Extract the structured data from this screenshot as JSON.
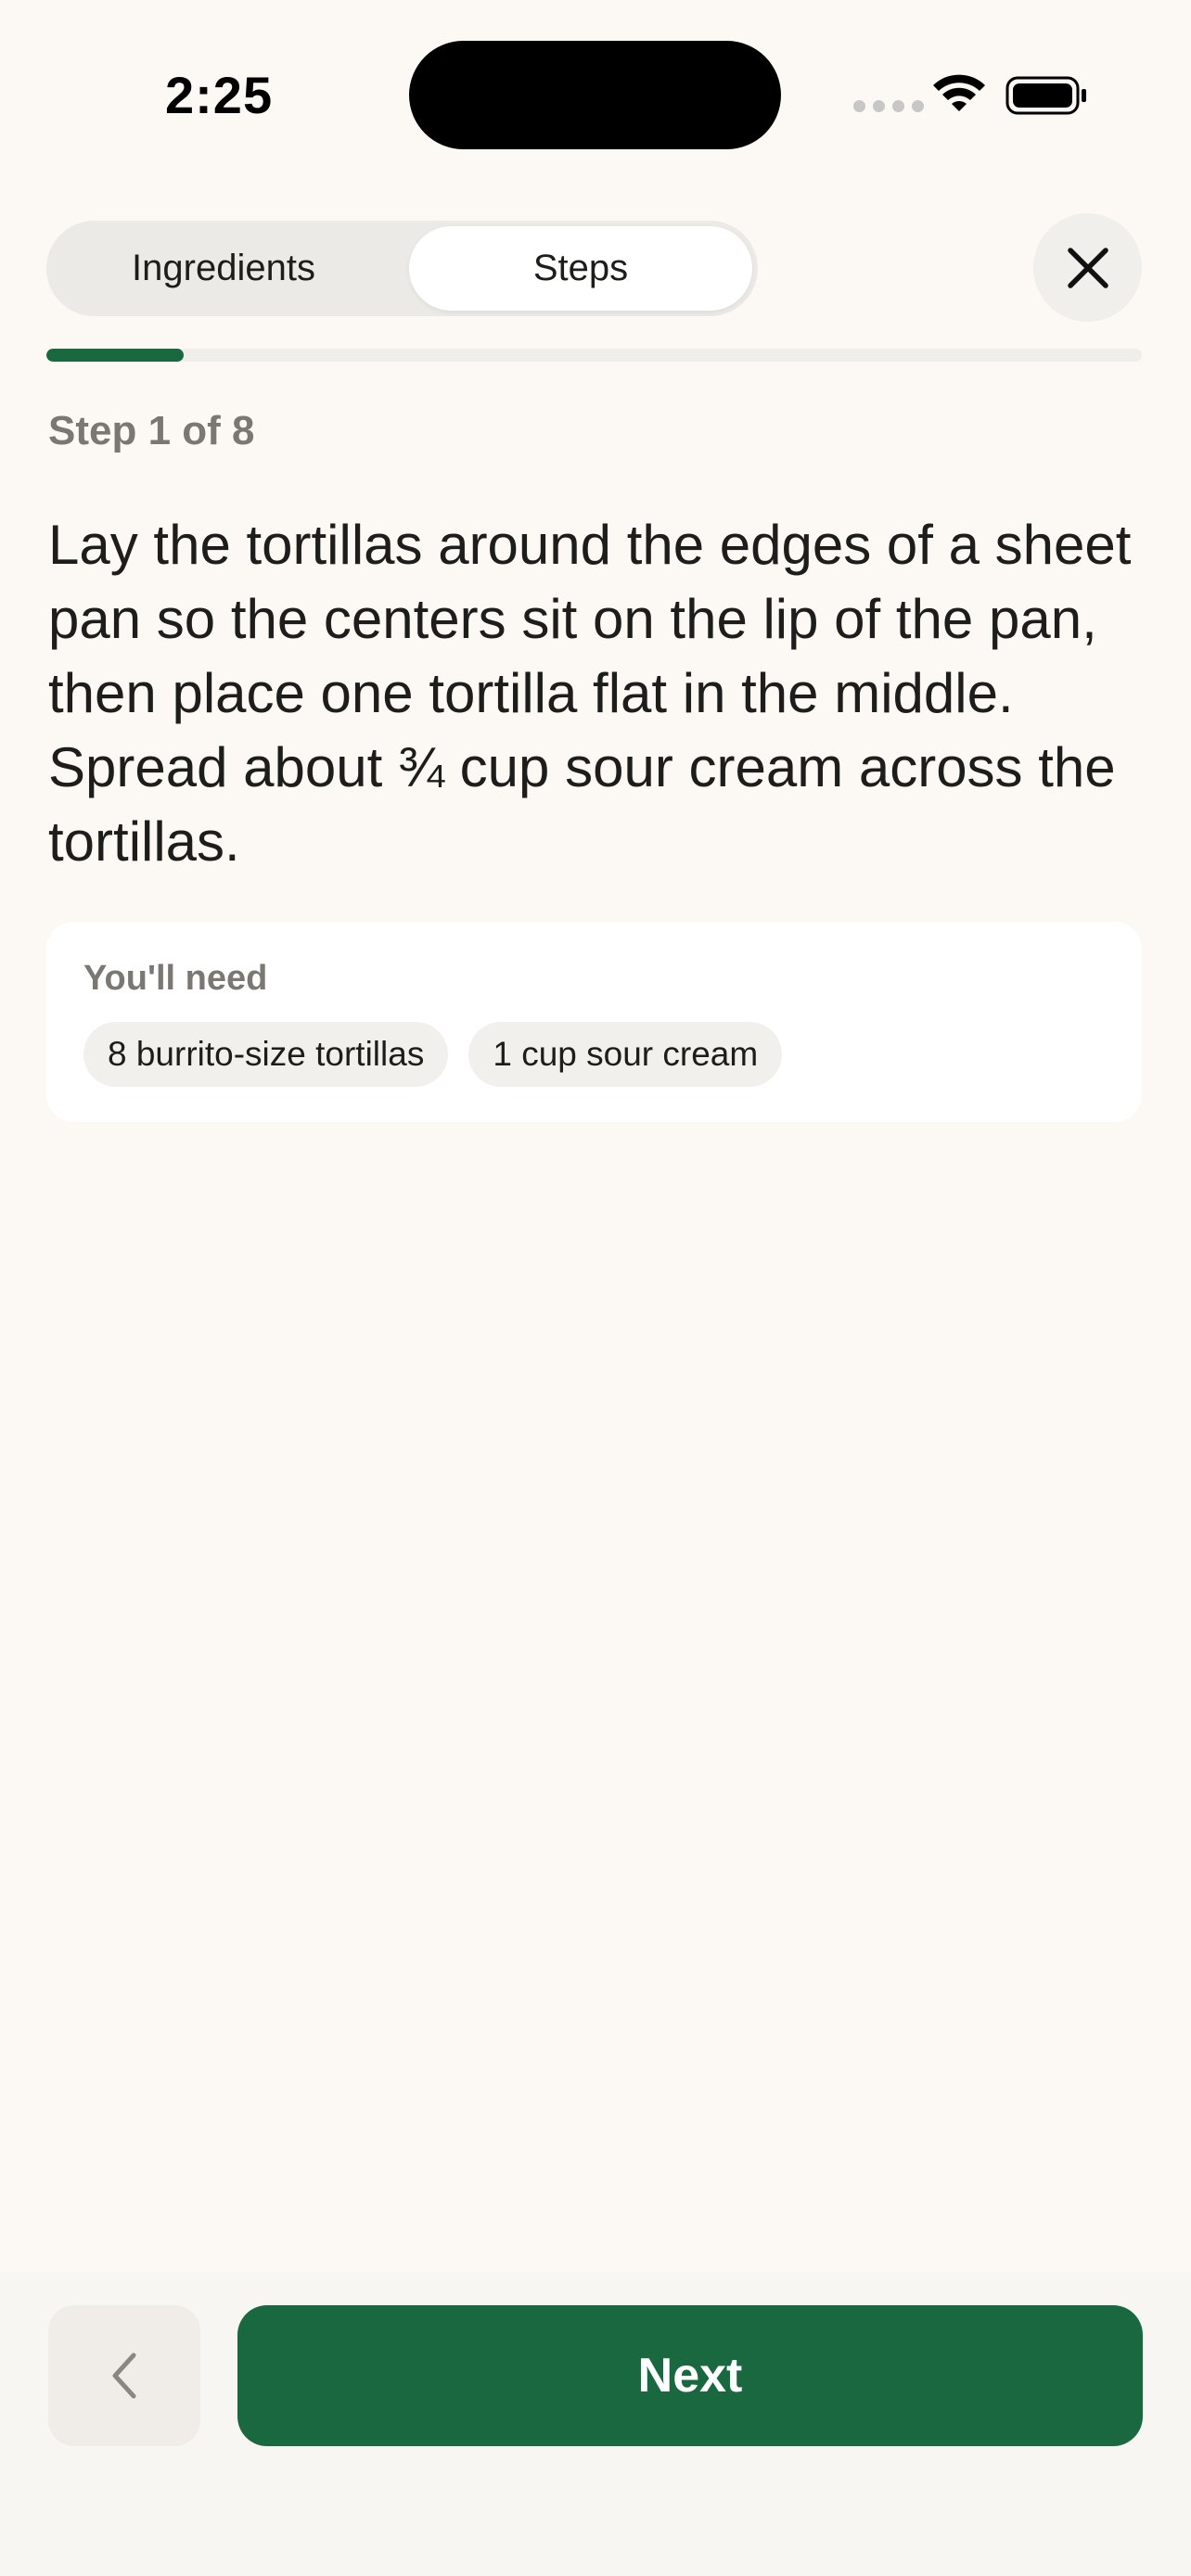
{
  "status_bar": {
    "time": "2:25"
  },
  "tabs": [
    {
      "label": "Ingredients",
      "selected": false
    },
    {
      "label": "Steps",
      "selected": true
    }
  ],
  "progress": {
    "current": 1,
    "total": 8,
    "fraction": 0.125
  },
  "step": {
    "counter_text": "Step 1 of 8",
    "instruction": "Lay the tortillas around the edges of a sheet pan so the centers sit on the lip of the pan, then place one tortilla flat in the middle. Spread about ¾ cup sour cream across the tortillas."
  },
  "needs": {
    "title": "You'll need",
    "items": [
      "8 burrito-size tortillas",
      "1 cup sour cream"
    ]
  },
  "navigation": {
    "next_label": "Next"
  },
  "colors": {
    "accent": "#1a6840",
    "background": "#fcf9f5"
  },
  "icons": {
    "close": "close-icon",
    "back": "chevron-left-icon"
  }
}
